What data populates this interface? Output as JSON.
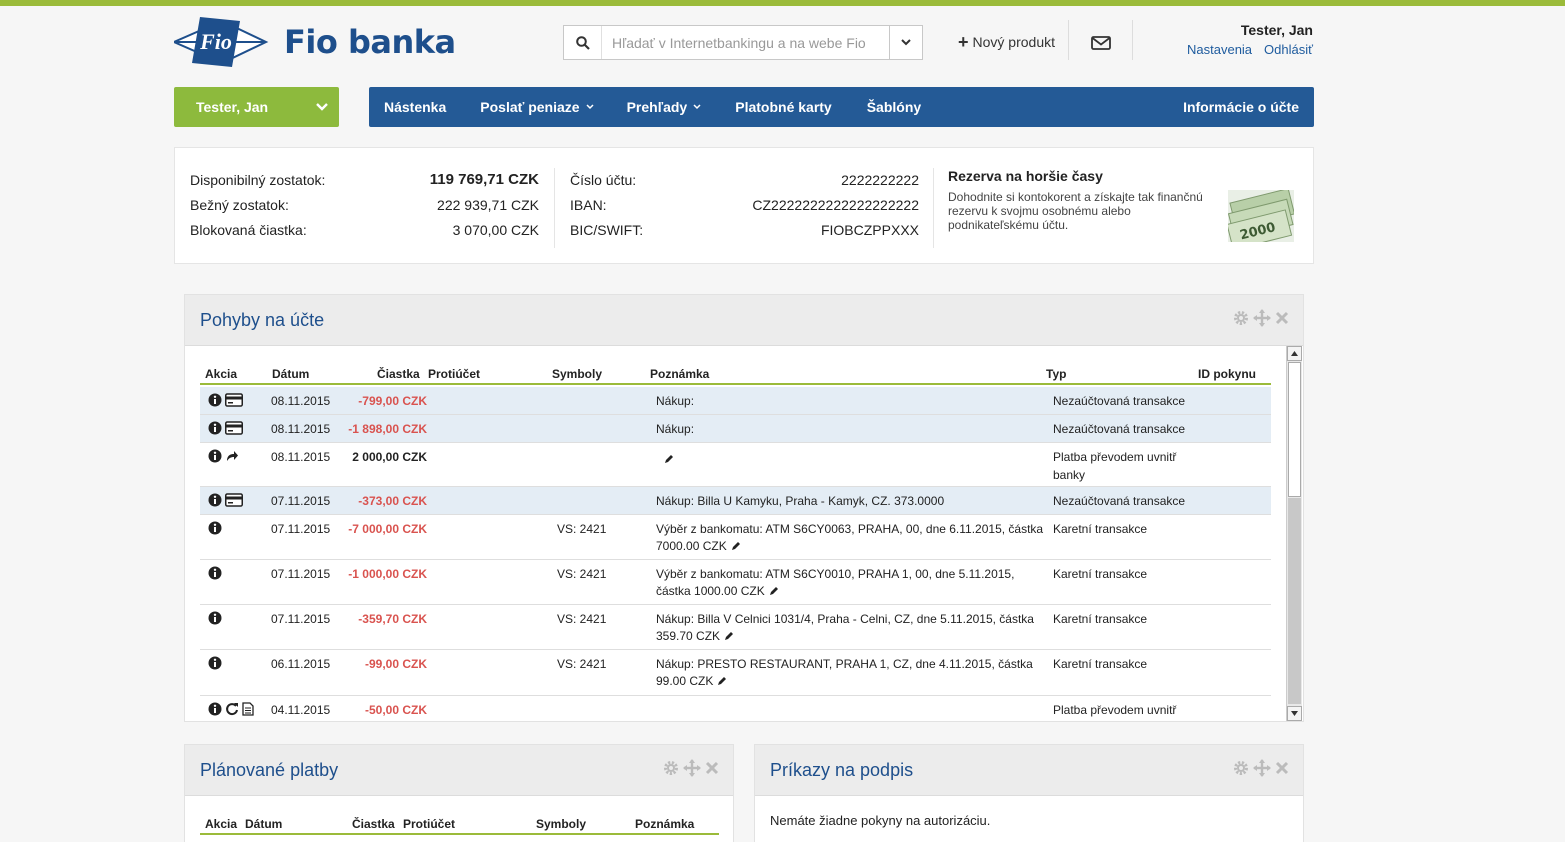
{
  "header": {
    "logo_badge": "Fio",
    "logo_text": "Fio banka",
    "search_placeholder": "Hľadať v Internetbankingu a na webe Fio",
    "new_product": "Nový produkt",
    "user_name": "Tester, Jan",
    "link_settings": "Nastavenia",
    "link_logout": "Odhlásiť"
  },
  "nav": {
    "account": "Tester, Jan",
    "items": [
      "Nástenka",
      "Poslať peniaze",
      "Prehľady",
      "Platobné karty",
      "Šablóny"
    ],
    "right_item": "Informácie o účte"
  },
  "balance": {
    "available_label": "Disponibilný zostatok:",
    "available_value": "119 769,71 CZK",
    "current_label": "Bežný zostatok:",
    "current_value": "222 939,71 CZK",
    "blocked_label": "Blokovaná čiastka:",
    "blocked_value": "3 070,00 CZK",
    "account_no_label": "Číslo účtu:",
    "account_no_value": "2222222222",
    "iban_label": "IBAN:",
    "iban_value": "CZ2222222222222222222",
    "bic_label": "BIC/SWIFT:",
    "bic_value": "FIOBCZPPXXX"
  },
  "promo": {
    "title": "Rezerva na horšie časy",
    "text": "Dohodnite si kontokorent a získajte tak finančnú rezervu k svojmu osobnému alebo podnikateľskému účtu.",
    "image_text": "2000"
  },
  "movements": {
    "title": "Pohyby na účte",
    "columns": [
      "Akcia",
      "Dátum",
      "Čiastka",
      "Protiúčet",
      "Symboly",
      "Poznámka",
      "Typ",
      "ID pokynu"
    ],
    "rows": [
      {
        "date": "08.11.2015",
        "amount": "-799,00 CZK",
        "sign": "neg",
        "symbols": "",
        "note": "Nákup:",
        "edit": false,
        "type": "Nezaúčtovaná transakce",
        "icons": [
          "info",
          "card"
        ],
        "shaded": true
      },
      {
        "date": "08.11.2015",
        "amount": "-1 898,00 CZK",
        "sign": "neg",
        "symbols": "",
        "note": "Nákup:",
        "edit": false,
        "type": "Nezaúčtovaná transakce",
        "icons": [
          "info",
          "card"
        ],
        "shaded": true
      },
      {
        "date": "08.11.2015",
        "amount": "2 000,00 CZK",
        "sign": "pos",
        "symbols": "",
        "note": "",
        "edit": true,
        "type": "Platba převodem uvnitř banky",
        "icons": [
          "info",
          "forward"
        ],
        "shaded": false
      },
      {
        "date": "07.11.2015",
        "amount": "-373,00 CZK",
        "sign": "neg",
        "symbols": "",
        "note": "Nákup: Billa U Kamyku, Praha - Kamyk, CZ. 373.0000",
        "edit": false,
        "type": "Nezaúčtovaná transakce",
        "icons": [
          "info",
          "card"
        ],
        "shaded": true
      },
      {
        "date": "07.11.2015",
        "amount": "-7 000,00 CZK",
        "sign": "neg",
        "symbols": "VS: 2421",
        "note": "Výběr z bankomatu: ATM S6CY0063, PRAHA, 00, dne 6.11.2015, částka 7000.00 CZK",
        "edit": true,
        "type": "Karetní transakce",
        "icons": [
          "info"
        ],
        "shaded": false
      },
      {
        "date": "07.11.2015",
        "amount": "-1 000,00 CZK",
        "sign": "neg",
        "symbols": "VS: 2421",
        "note": "Výběr z bankomatu: ATM S6CY0010, PRAHA 1, 00, dne 5.11.2015, částka 1000.00 CZK",
        "edit": true,
        "type": "Karetní transakce",
        "icons": [
          "info"
        ],
        "shaded": false
      },
      {
        "date": "07.11.2015",
        "amount": "-359,70 CZK",
        "sign": "neg",
        "symbols": "VS: 2421",
        "note": "Nákup: Billa V Celnici 1031/4, Praha - Celni, CZ, dne 5.11.2015, částka 359.70 CZK",
        "edit": true,
        "type": "Karetní transakce",
        "icons": [
          "info"
        ],
        "shaded": false
      },
      {
        "date": "06.11.2015",
        "amount": "-99,00 CZK",
        "sign": "neg",
        "symbols": "VS: 2421",
        "note": "Nákup: PRESTO RESTAURANT, PRAHA 1, CZ, dne 4.11.2015, částka 99.00 CZK",
        "edit": true,
        "type": "Karetní transakce",
        "icons": [
          "info"
        ],
        "shaded": false
      },
      {
        "date": "04.11.2015",
        "amount": "-50,00 CZK",
        "sign": "neg",
        "symbols": "",
        "note": "",
        "edit": false,
        "type": "Platba převodem uvnitř banky",
        "icons": [
          "info",
          "repeat",
          "document"
        ],
        "shaded": false
      }
    ]
  },
  "planned": {
    "title": "Plánované platby",
    "columns": [
      "Akcia",
      "Dátum",
      "Čiastka",
      "Protiúčet",
      "Symboly",
      "Poznámka"
    ]
  },
  "signing": {
    "title": "Príkazy na podpis",
    "empty_message": "Nemáte žiadne pokyny na autorizáciu."
  },
  "colors": {
    "brand_blue": "#245a96",
    "brand_green": "#8dba3d",
    "negative": "#d9534f",
    "row_shade": "#e4edf5"
  }
}
